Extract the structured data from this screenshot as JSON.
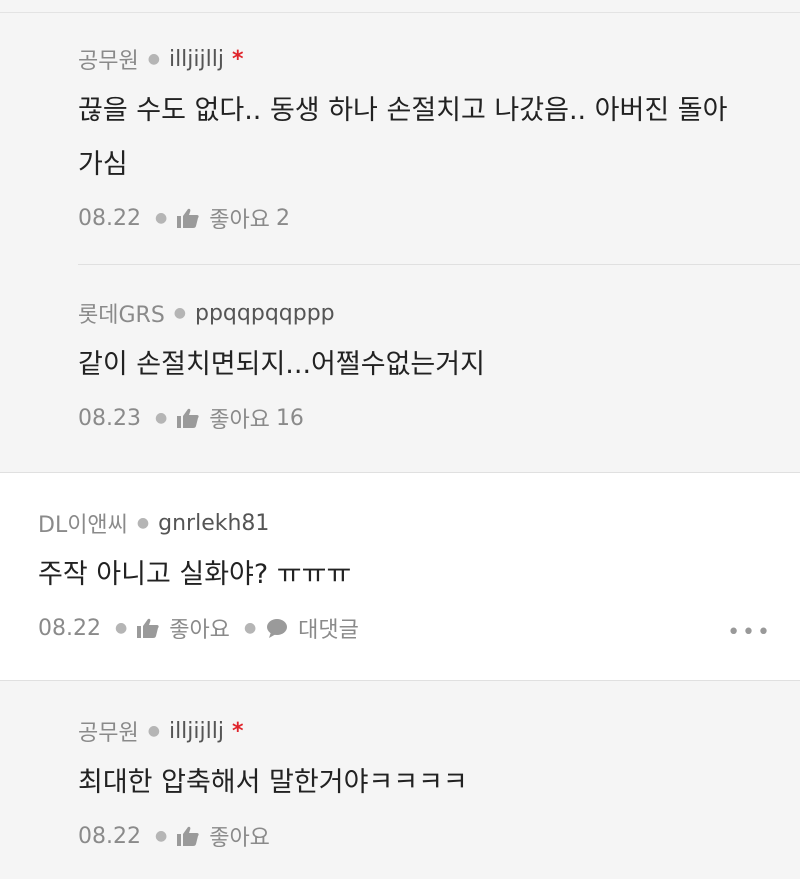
{
  "comments": [
    {
      "nick": "공무원",
      "user_id": "illjijllj",
      "author_mark": "*",
      "text": "끊을 수도 없다.. 동생 하나 손절치고 나갔음.. 아버진 돌아\n가심",
      "date": "08.22",
      "like_label": "좋아요",
      "like_count": "2"
    },
    {
      "nick": "롯데GRS",
      "user_id": "ppqqpqqppp",
      "text": "같이 손절치면되지...어쩔수없는거지",
      "date": "08.23",
      "like_label": "좋아요",
      "like_count": "16"
    },
    {
      "nick": "DL이앤씨",
      "user_id": "gnrlekh81",
      "text": "주작 아니고 실화야? ㅠㅠㅠ",
      "date": "08.22",
      "like_label": "좋아요",
      "reply_label": "대댓글",
      "more": "•••"
    },
    {
      "nick": "공무원",
      "user_id": "illjijllj",
      "author_mark": "*",
      "text": "최대한 압축해서 말한거야ㅋㅋㅋㅋ",
      "date": "08.22",
      "like_label": "좋아요"
    }
  ]
}
